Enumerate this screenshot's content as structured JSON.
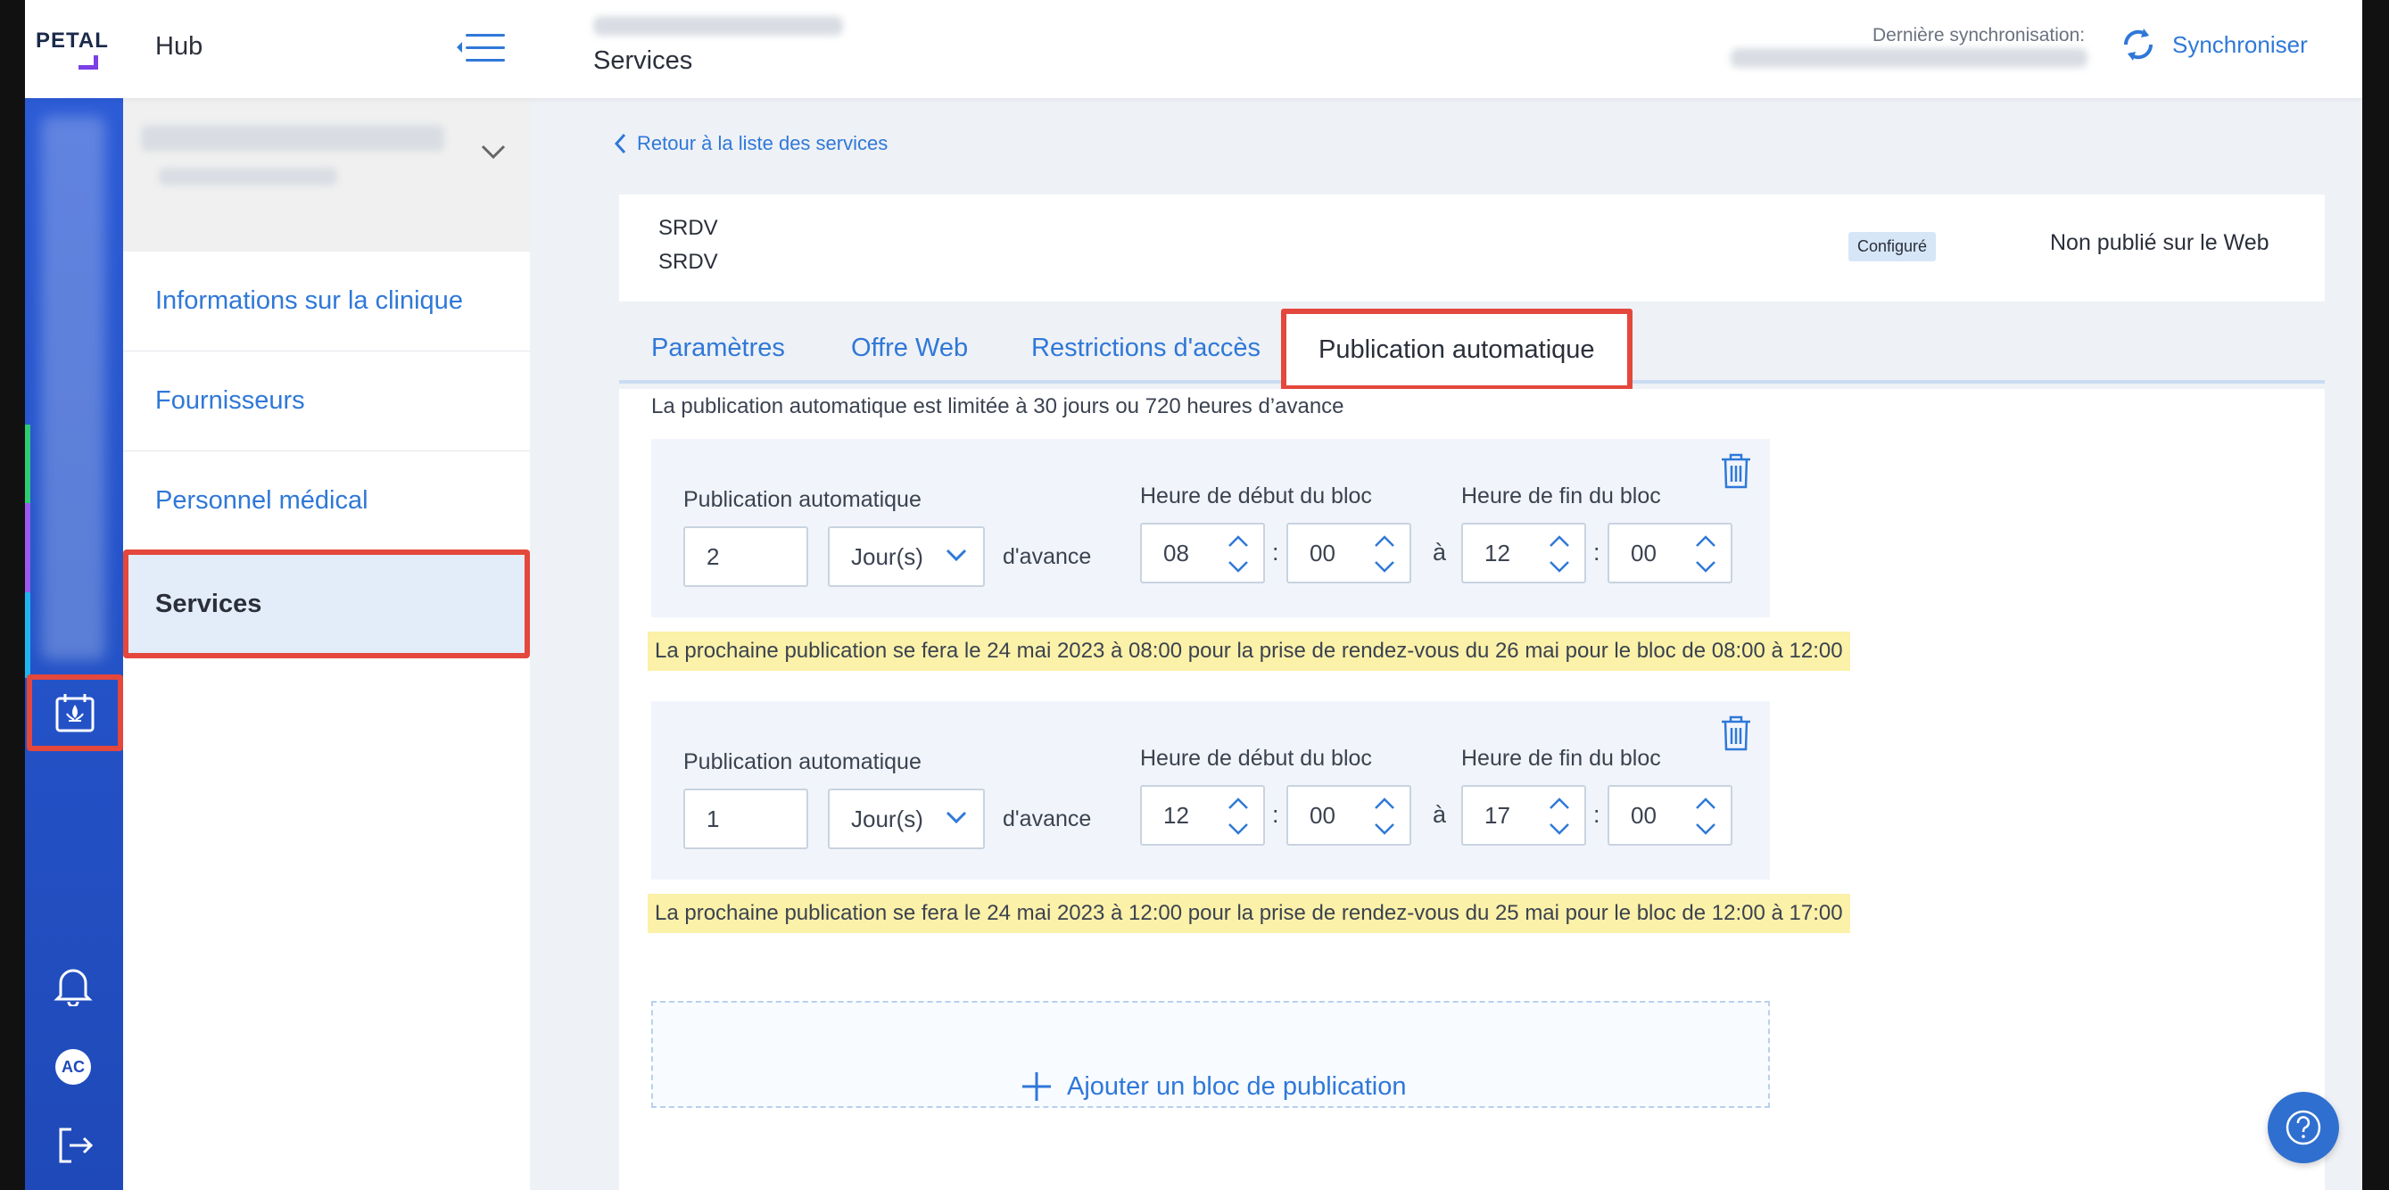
{
  "app": {
    "logo_text": "PETAL",
    "hub_label": "Hub"
  },
  "header": {
    "page_title": "Services",
    "sync_label": "Dernière synchronisation:",
    "sync_button": "Synchroniser"
  },
  "rail": {
    "avatar_initials": "AC"
  },
  "sidebar": {
    "items": [
      {
        "label": "Informations sur la clinique"
      },
      {
        "label": "Fournisseurs"
      },
      {
        "label": "Personnel médical"
      },
      {
        "label": "Services"
      }
    ],
    "active_index": 3
  },
  "main": {
    "back_link": "Retour à la liste des services",
    "service": {
      "line1": "SRDV",
      "line2": "SRDV",
      "badge": "Configuré",
      "web_status": "Non publié sur le Web"
    },
    "tabs": [
      {
        "label": "Paramètres"
      },
      {
        "label": "Offre Web"
      },
      {
        "label": "Restrictions d'accès"
      },
      {
        "label": "Publication automatique"
      }
    ],
    "active_tab": 3,
    "limit_text": "La publication automatique est limitée à 30 jours ou 720 heures d’avance",
    "labels": {
      "auto_pub": "Publication automatique",
      "advance": "d'avance",
      "start": "Heure de début du bloc",
      "end": "Heure de fin du bloc",
      "to": "à",
      "colon": ":"
    },
    "blocks": [
      {
        "advance_value": "2",
        "unit": "Jour(s)",
        "start_h": "08",
        "start_m": "00",
        "end_h": "12",
        "end_m": "00",
        "note": "La prochaine publication se fera le 24 mai 2023 à 08:00 pour la prise de rendez-vous du 26 mai pour le bloc de 08:00 à 12:00"
      },
      {
        "advance_value": "1",
        "unit": "Jour(s)",
        "start_h": "12",
        "start_m": "00",
        "end_h": "17",
        "end_m": "00",
        "note": "La prochaine publication se fera le 24 mai 2023 à 12:00 pour la prise de rendez-vous du 25 mai pour le bloc de 12:00 à 17:00"
      }
    ],
    "add_block": "Ajouter un bloc de publication"
  },
  "colors": {
    "accent": "#2f78d8",
    "rail": "#2453c8",
    "highlight": "#e4473c",
    "note_bg": "#fbf1a8"
  }
}
